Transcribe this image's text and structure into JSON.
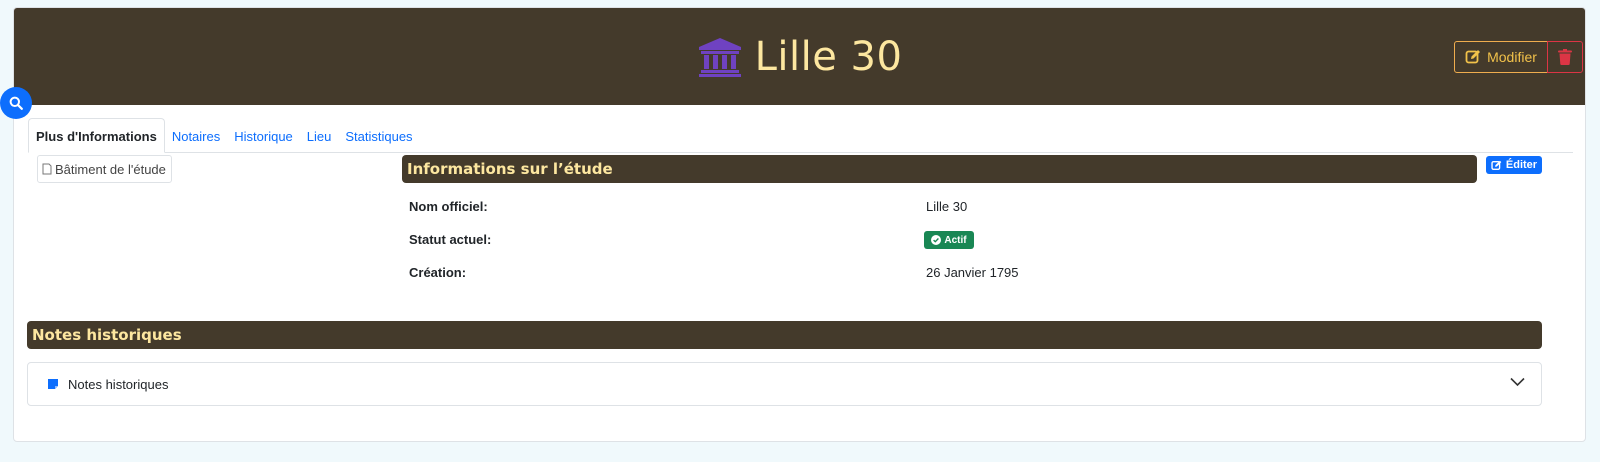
{
  "header": {
    "title": "Lille 30",
    "title_icon": "bank-icon",
    "modifier_label": "Modifier",
    "title_color": "#fde7a0",
    "icon_color": "#6f42c1",
    "bar_color": "#443a2b"
  },
  "tabs": [
    {
      "label": "Plus d'Informations",
      "active": true
    },
    {
      "label": "Notaires"
    },
    {
      "label": "Historique"
    },
    {
      "label": "Lieu"
    },
    {
      "label": "Statistiques"
    }
  ],
  "image": {
    "alt": "Bâtiment de l'étude"
  },
  "info": {
    "title": "Informations sur l’étude",
    "edit_label": "Éditer",
    "rows": [
      {
        "label": "Nom officiel:",
        "value": "Lille 30"
      },
      {
        "label": "Statut actuel:",
        "value": "Actif"
      },
      {
        "label": "Création:",
        "value": "26 Janvier 1795"
      }
    ]
  },
  "notes": {
    "title": "Notes historiques",
    "accordion_label": "Notes historiques"
  }
}
